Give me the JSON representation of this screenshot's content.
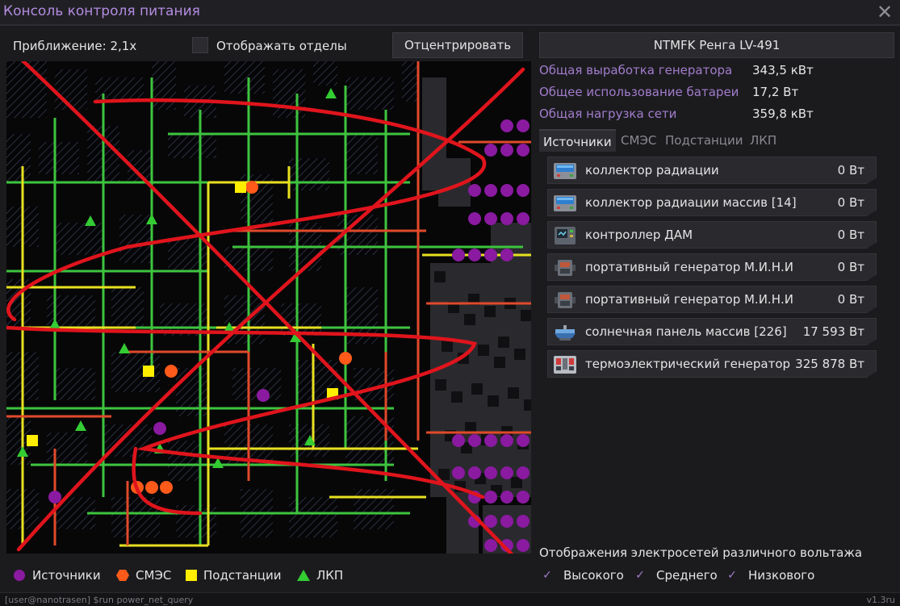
{
  "window": {
    "title": "Консоль контроля питания",
    "close_glyph": "✕"
  },
  "toolbar": {
    "zoom_label": "Приближение: 2,1x",
    "departments_label": "Отображать отделы",
    "center_button": "Отцентрировать"
  },
  "network": {
    "name": "NTMFK Ренга LV-491",
    "stats": [
      {
        "label": "Общая выработка генератора",
        "value": "343,5 кВт"
      },
      {
        "label": "Общее использование батареи",
        "value": "17,2 Вт"
      },
      {
        "label": "Общая нагрузка сети",
        "value": "359,8 кВт"
      }
    ]
  },
  "tabs": [
    {
      "label": "Источники",
      "active": true
    },
    {
      "label": "СМЭС",
      "active": false
    },
    {
      "label": "Подстанции",
      "active": false
    },
    {
      "label": "ЛКП",
      "active": false
    }
  ],
  "sources": [
    {
      "name": "коллектор радиации",
      "value": "0 Вт",
      "icon": "radiation-collector-icon"
    },
    {
      "name": "коллектор радиации массив [14]",
      "value": "0 Вт",
      "icon": "radiation-collector-icon"
    },
    {
      "name": "контроллер ДАМ",
      "value": "0 Вт",
      "icon": "computer-terminal-icon"
    },
    {
      "name": "портативный генератор М.И.Н.И",
      "value": "0 Вт",
      "icon": "portable-generator-icon"
    },
    {
      "name": "портативный генератор М.И.Н.И",
      "value": "0 Вт",
      "icon": "portable-generator-icon"
    },
    {
      "name": "солнечная панель массив [226]",
      "value": "17 593 Вт",
      "icon": "solar-panel-icon"
    },
    {
      "name": "термоэлектрический генератор",
      "value": "325 878 Вт",
      "icon": "thermoelectric-generator-icon"
    }
  ],
  "legend": [
    {
      "label": "Источники",
      "shape": "circle",
      "color": "#8a1aa0"
    },
    {
      "label": "СМЭС",
      "shape": "hexagon",
      "color": "#ff5a1a"
    },
    {
      "label": "Подстанции",
      "shape": "square",
      "color": "#ffee00"
    },
    {
      "label": "ЛКП",
      "shape": "triangle",
      "color": "#33cc33"
    }
  ],
  "voltage": {
    "title": "Отображения электросетей различного вольтажа",
    "options": [
      {
        "label": "Высокого",
        "checked": true
      },
      {
        "label": "Среднего",
        "checked": true
      },
      {
        "label": "Низкового",
        "checked": true
      }
    ],
    "check_glyph": "✓"
  },
  "status_bar": {
    "command": "[user@nanotrasen] $run power_net_query",
    "version": "v1.3ru"
  },
  "colors": {
    "accent": "#a27ccc",
    "source": "#8a1aa0",
    "smes": "#ff5a1a",
    "substation": "#ffee00",
    "apc": "#33cc33",
    "hv_cable": "#e04a2a",
    "mv_cable": "#e8e020",
    "lv_cable": "#3ec43e",
    "annotation": "#e0141c"
  }
}
